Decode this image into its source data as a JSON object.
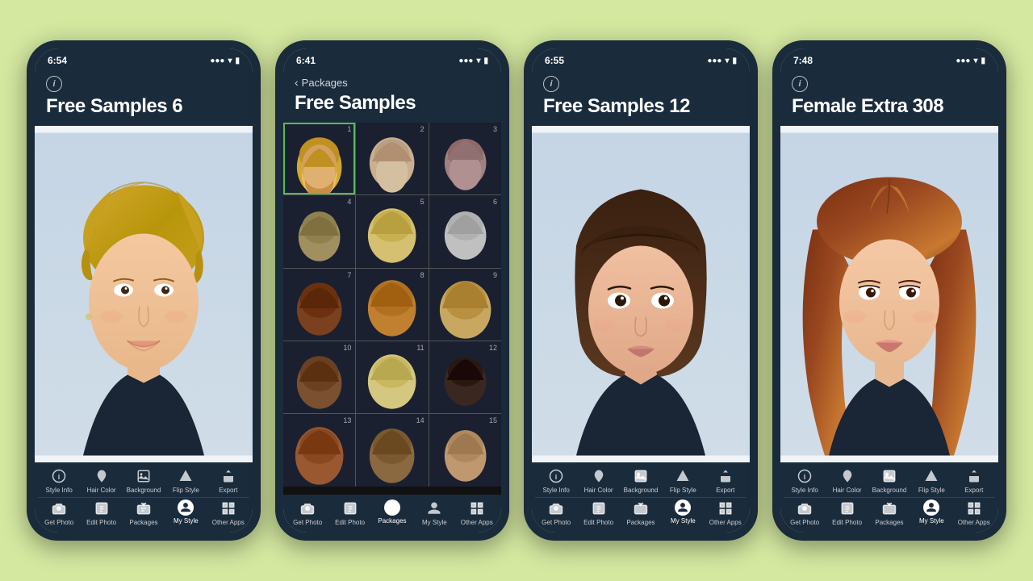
{
  "background_color": "#d4e8a0",
  "phones": [
    {
      "id": "phone1",
      "time": "6:54",
      "back_nav": null,
      "title": "Free Samples 6",
      "view": "single",
      "active_tab_bottom": "my_style",
      "toolbar_top": [
        "Style Info",
        "Hair Color",
        "Background",
        "Flip Style",
        "Export"
      ],
      "toolbar_bottom": [
        "Get Photo",
        "Edit Photo",
        "Packages",
        "My Style",
        "Other Apps"
      ]
    },
    {
      "id": "phone2",
      "time": "6:41",
      "back_nav": "Packages",
      "title": "Free Samples",
      "view": "grid",
      "active_tab_bottom": "packages",
      "grid_count": 15,
      "toolbar_top": [],
      "toolbar_bottom": [
        "Get Photo",
        "Edit Photo",
        "Packages",
        "My Style",
        "Other Apps"
      ]
    },
    {
      "id": "phone3",
      "time": "6:55",
      "back_nav": null,
      "title": "Free Samples 12",
      "view": "single",
      "active_tab_bottom": "my_style",
      "toolbar_top": [
        "Style Info",
        "Hair Color",
        "Background",
        "Flip Style",
        "Export"
      ],
      "toolbar_bottom": [
        "Get Photo",
        "Edit Photo",
        "Packages",
        "My Style",
        "Other Apps"
      ]
    },
    {
      "id": "phone4",
      "time": "7:48",
      "back_nav": null,
      "title": "Female Extra 308",
      "view": "single",
      "active_tab_bottom": "my_style",
      "toolbar_top": [
        "Style Info",
        "Hair Color",
        "Background",
        "Flip Style",
        "Export"
      ],
      "toolbar_bottom": [
        "Get Photo",
        "Edit Photo",
        "Packages",
        "My Style",
        "Other Apps"
      ]
    }
  ]
}
